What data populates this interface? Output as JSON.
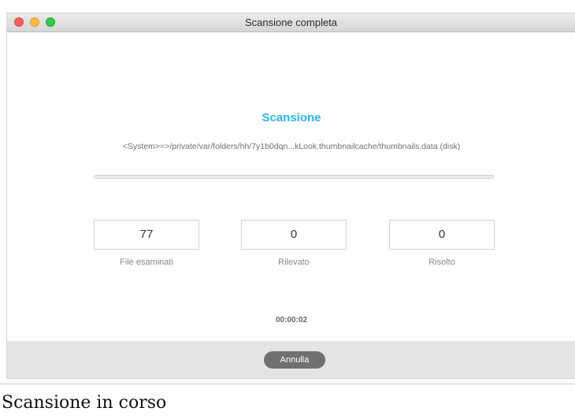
{
  "window": {
    "title": "Scansione completa"
  },
  "scan": {
    "heading": "Scansione",
    "current_path": "<System>=>/private/var/folders/hh/7y1b0dqn...kLook.thumbnailcache/thumbnails.data (disk)",
    "progress_fraction": 0,
    "elapsed": "00:00:02"
  },
  "stats": [
    {
      "value": "77",
      "label": "File esaminati"
    },
    {
      "value": "0",
      "label": "Rilevato"
    },
    {
      "value": "0",
      "label": "Risolto"
    }
  ],
  "footer": {
    "cancel_label": "Annulla"
  },
  "caption": "Scansione in corso",
  "colors": {
    "accent": "#29b6f0",
    "close": "#fc605c",
    "minimize": "#fdbc40",
    "zoom": "#34c84a",
    "button": "#707070"
  }
}
